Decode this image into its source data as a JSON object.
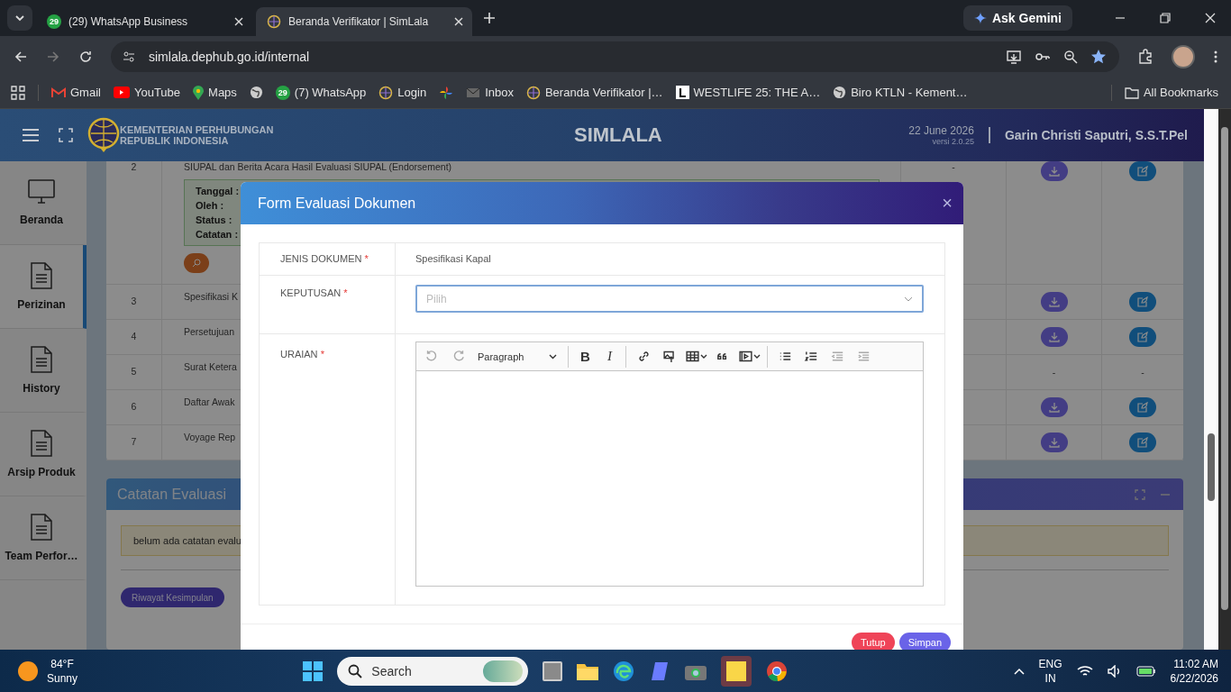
{
  "browser": {
    "tabs": [
      {
        "kind": "whatsapp",
        "badge": "29",
        "title": "(29) WhatsApp Business",
        "selected": false
      },
      {
        "kind": "ministry",
        "title": "Beranda Verifikator | SimLala",
        "selected": true
      }
    ],
    "gemini": "Ask Gemini",
    "url": "simlala.dephub.go.id/internal",
    "bookmarks": [
      {
        "kind": "gmail",
        "label": "Gmail"
      },
      {
        "kind": "youtube",
        "label": "YouTube"
      },
      {
        "kind": "maps",
        "label": "Maps"
      },
      {
        "kind": "globe"
      },
      {
        "kind": "whatsapp",
        "badge": "29",
        "label": "(7) WhatsApp"
      },
      {
        "kind": "ministry",
        "label": "Login"
      },
      {
        "kind": "pinwheel"
      },
      {
        "kind": "mail",
        "label": "Inbox"
      },
      {
        "kind": "ministry",
        "label": "Beranda Verifikator |…"
      },
      {
        "kind": "letter",
        "label": "WESTLIFE 25: THE A…"
      },
      {
        "kind": "globe",
        "label": "Biro KTLN - Kement…"
      }
    ],
    "all_bookmarks": "All Bookmarks"
  },
  "header": {
    "org_line1": "KEMENTERIAN PERHUBUNGAN",
    "org_line2": "REPUBLIK INDONESIA",
    "app": "SIMLALA",
    "date": "22 June 2026",
    "version": "versi 2.0.25",
    "user": "Garin Christi Saputri, S.S.T.Pel"
  },
  "sidebar": [
    {
      "kind": "monitor",
      "label": "Beranda",
      "selected": false
    },
    {
      "kind": "document",
      "label": "Perizinan",
      "selected": true
    },
    {
      "kind": "document",
      "label": "History",
      "selected": false
    },
    {
      "kind": "document",
      "label": "Arsip Produk",
      "selected": false
    },
    {
      "kind": "document",
      "label": "Team Perfor…",
      "selected": false
    }
  ],
  "table": {
    "rows": [
      {
        "no": "2",
        "document": "SIUPAL dan Berita Acara Hasil Evaluasi SIUPAL (Endorsement)",
        "detail": [
          {
            "label": "Tanggal :"
          },
          {
            "label": "Oleh :"
          },
          {
            "label": "Status :"
          },
          {
            "label": "Catatan :"
          }
        ],
        "column_3": "-",
        "has_files": true
      },
      {
        "no": "3",
        "document": "Spesifikasi K",
        "has_files": true
      },
      {
        "no": "4",
        "document": "Persetujuan",
        "has_files": true
      },
      {
        "no": "5",
        "document": "Surat Ketera",
        "has_files": false,
        "download_text": "-",
        "edit_text": "-"
      },
      {
        "no": "6",
        "document": "Daftar Awak",
        "has_files": true
      },
      {
        "no": "7",
        "document": "Voyage Rep",
        "has_files": true
      }
    ]
  },
  "evaluation_notes": {
    "title": "Catatan Evaluasi",
    "note": "belum ada catatan evalu",
    "buttons": [
      "Riwayat Kesimpulan"
    ]
  },
  "modal": {
    "title": "Form Evaluasi Dokumen",
    "close": "×",
    "fields": [
      {
        "kind": "text",
        "label": "JENIS DOKUMEN",
        "required_mark": "*",
        "value": "Spesifikasi Kapal"
      },
      {
        "kind": "select",
        "label": "KEPUTUSAN",
        "required_mark": "*",
        "placeholder": "Pilih"
      },
      {
        "kind": "editor",
        "label": "URAIAN",
        "required_mark": "*",
        "format": "Paragraph",
        "toolbar": [
          {
            "kind": "undo",
            "disabled": true
          },
          {
            "kind": "redo",
            "disabled": true
          },
          {
            "kind": "format"
          },
          {
            "kind": "sep"
          },
          {
            "kind": "bold",
            "label": "B",
            "disabled": false
          },
          {
            "kind": "italic",
            "label": "I",
            "disabled": false
          },
          {
            "kind": "sep"
          },
          {
            "kind": "link",
            "disabled": false
          },
          {
            "kind": "image",
            "disabled": false
          },
          {
            "kind": "table",
            "disabled": false
          },
          {
            "kind": "quote",
            "disabled": false
          },
          {
            "kind": "media",
            "disabled": false
          },
          {
            "kind": "sep"
          },
          {
            "kind": "bullets",
            "disabled": false
          },
          {
            "kind": "numbers",
            "disabled": false
          },
          {
            "kind": "outdent",
            "disabled": true
          },
          {
            "kind": "indent",
            "disabled": true
          }
        ]
      }
    ],
    "buttons": [
      {
        "kind": "danger",
        "label": "Tutup"
      },
      {
        "kind": "primary",
        "label": "Simpan"
      }
    ]
  },
  "taskbar": {
    "weather_temp": "84°F",
    "weather_text": "Sunny",
    "search": "Search",
    "language": "ENG",
    "region": "IN",
    "time": "11:02 AM",
    "date": "6/22/2026"
  }
}
